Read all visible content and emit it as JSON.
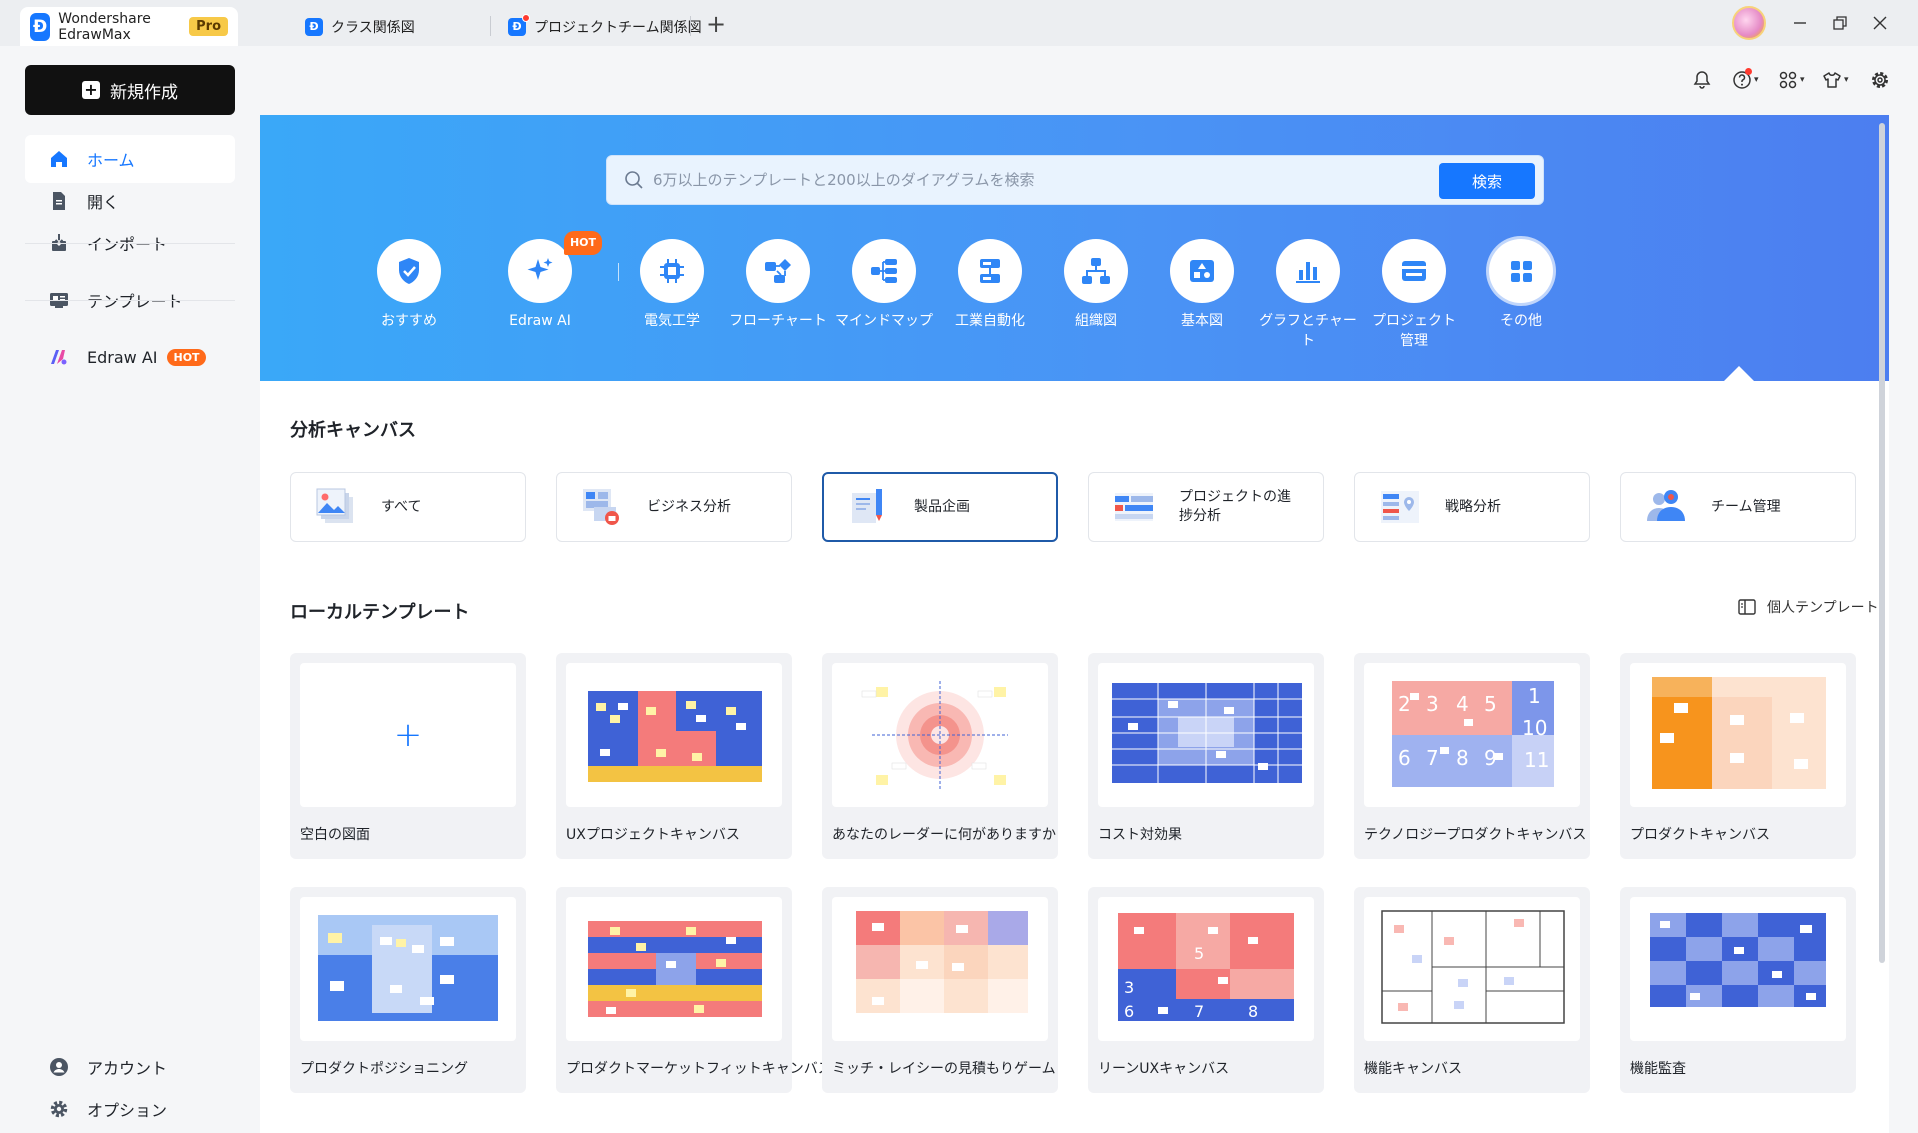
{
  "titlebar": {
    "app_name": "Wondershare EdrawMax",
    "plan_badge": "Pro",
    "tabs": [
      {
        "label": "クラス関係図"
      },
      {
        "label": "プロジェクトチーム関係図"
      }
    ],
    "new_tab": "+"
  },
  "sidebar": {
    "new_button": "新規作成",
    "nav": [
      {
        "label": "ホーム",
        "icon": "home-icon"
      },
      {
        "label": "開く",
        "icon": "open-file-icon"
      },
      {
        "label": "インポート",
        "icon": "import-icon"
      },
      {
        "label": "テンプレート",
        "icon": "template-icon"
      },
      {
        "label": "Edraw AI",
        "icon": "edraw-ai-icon",
        "badge": "HOT"
      }
    ],
    "bottom": [
      {
        "label": "アカウント",
        "icon": "account-icon"
      },
      {
        "label": "オプション",
        "icon": "settings-icon"
      }
    ]
  },
  "search": {
    "placeholder": "6万以上のテンプレートと200以上のダイアグラムを検索",
    "button": "検索"
  },
  "categories": [
    {
      "label": "おすすめ",
      "icon": "recommend-icon"
    },
    {
      "label": "Edraw AI",
      "icon": "ai-sparkle-icon",
      "badge": "HOT"
    },
    {
      "label": "電気工学",
      "icon": "circuit-icon"
    },
    {
      "label": "フローチャート",
      "icon": "flowchart-icon"
    },
    {
      "label": "マインドマップ",
      "icon": "mindmap-icon"
    },
    {
      "label": "工業自動化",
      "icon": "automation-icon"
    },
    {
      "label": "組織図",
      "icon": "org-chart-icon"
    },
    {
      "label": "基本図",
      "icon": "basic-diagram-icon"
    },
    {
      "label": "グラフとチャー\nト",
      "icon": "bar-chart-icon"
    },
    {
      "label": "プロジェクト\n管理",
      "icon": "project-icon"
    },
    {
      "label": "その他",
      "icon": "more-grid-icon"
    }
  ],
  "canvas_section": {
    "title": "分析キャンバス",
    "chips": [
      {
        "label": "すべて"
      },
      {
        "label": "ビジネス分析"
      },
      {
        "label": "製品企画"
      },
      {
        "label": "プロジェクトの進捗分析"
      },
      {
        "label": "戦略分析"
      },
      {
        "label": "チーム管理"
      }
    ]
  },
  "local_section": {
    "title": "ローカルテンプレート",
    "personal_link": "個人テンプレート",
    "blank_plus": "+",
    "templates": [
      {
        "label": "空白の図面"
      },
      {
        "label": "UXプロジェクトキャンバス"
      },
      {
        "label": "あなたのレーダーに何がありますか"
      },
      {
        "label": "コスト対効果"
      },
      {
        "label": "テクノロジープロダクトキャンバス"
      },
      {
        "label": "プロダクトキャンバス"
      },
      {
        "label": "プロダクトポジショニング"
      },
      {
        "label": "プロダクトマーケットフィットキャンバス"
      },
      {
        "label": "ミッチ・レイシーの見積もりゲーム"
      },
      {
        "label": "リーンUXキャンバス"
      },
      {
        "label": "機能キャンバス"
      },
      {
        "label": "機能監査"
      }
    ],
    "tech_canvas_numbers": [
      "2",
      "3",
      "4",
      "5",
      "1",
      "10",
      "6",
      "7",
      "8",
      "9",
      "11"
    ],
    "lean_ux_numbers": [
      "3",
      "5",
      "6",
      "7",
      "8"
    ]
  },
  "colors": {
    "accent": "#1677ff",
    "hero_start": "#3aa8f8",
    "hero_end": "#4c7ef0",
    "hot": "#ff6a1a",
    "pro_badge": "#f7c948"
  }
}
